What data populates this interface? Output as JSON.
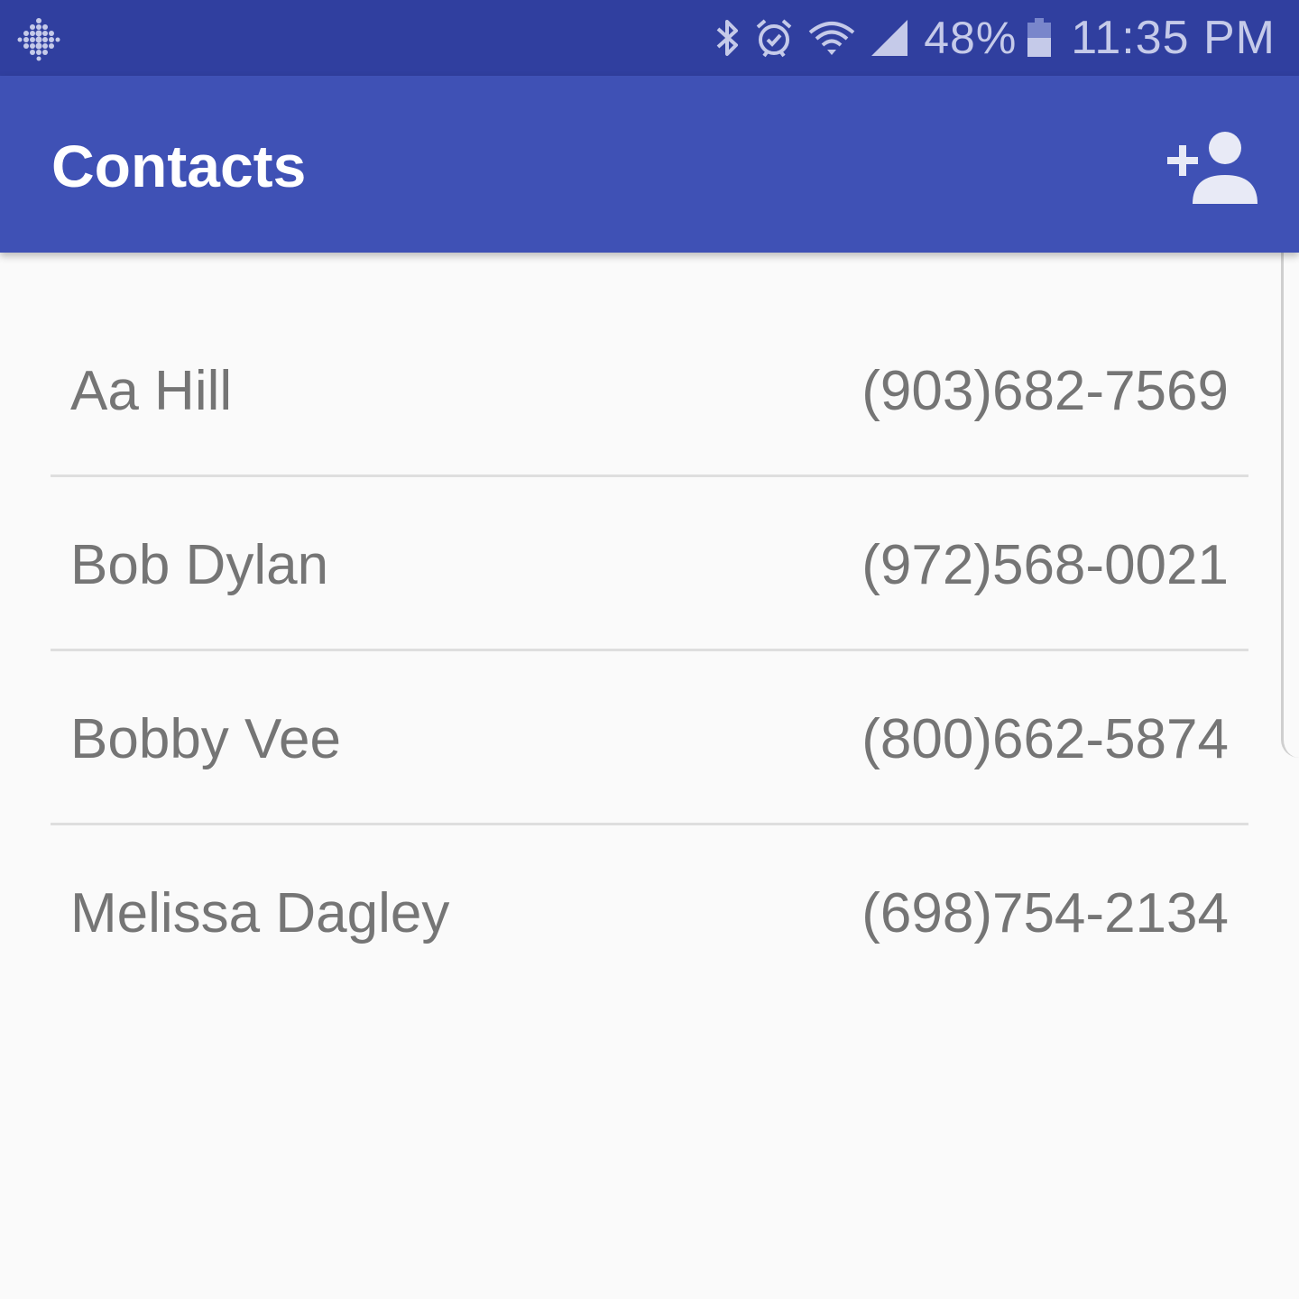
{
  "status_bar": {
    "left_icon": "fitbit-dots-icon",
    "icons": [
      "bluetooth-icon",
      "alarm-icon",
      "wifi-icon",
      "cell-signal-icon"
    ],
    "battery_percent": "48%",
    "battery_icon": "battery-icon",
    "time": "11:35 PM"
  },
  "app_bar": {
    "title": "Contacts",
    "add_icon": "add-person-icon",
    "color": "#3f51b5"
  },
  "contacts": [
    {
      "name": "Aa Hill",
      "phone": "(903)682-7569"
    },
    {
      "name": "Bob Dylan",
      "phone": "(972)568-0021"
    },
    {
      "name": "Bobby Vee",
      "phone": "(800)662-5874"
    },
    {
      "name": "Melissa Dagley",
      "phone": "(698)754-2134"
    }
  ]
}
